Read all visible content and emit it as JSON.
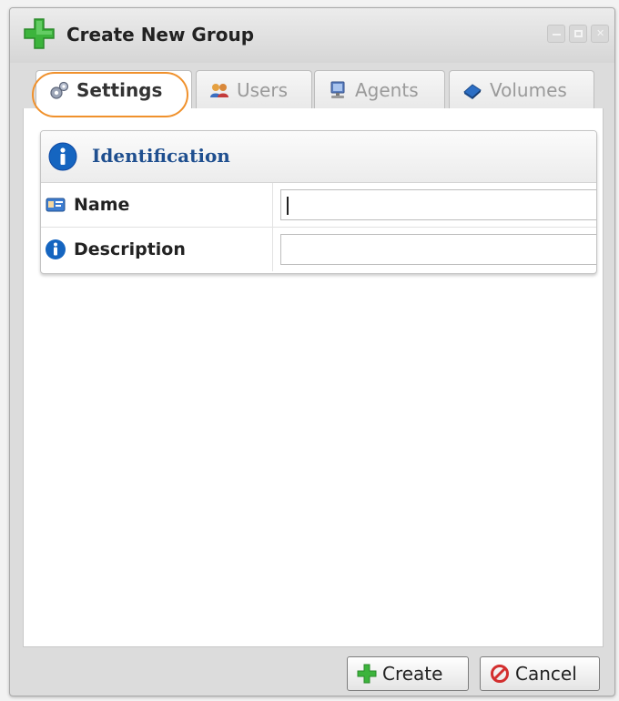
{
  "window": {
    "title": "Create New Group"
  },
  "tabs": [
    {
      "label": "Settings",
      "icon": "gears-icon",
      "active": true
    },
    {
      "label": "Users",
      "icon": "users-icon",
      "active": false
    },
    {
      "label": "Agents",
      "icon": "computer-icon",
      "active": false
    },
    {
      "label": "Volumes",
      "icon": "disk-icon",
      "active": false
    }
  ],
  "identification": {
    "title": "Identification",
    "fields": [
      {
        "label": "Name",
        "icon": "id-card-icon",
        "value": ""
      },
      {
        "label": "Description",
        "icon": "info-icon",
        "value": ""
      }
    ]
  },
  "footer": {
    "create_label": "Create",
    "cancel_label": "Cancel"
  },
  "colors": {
    "accent_green": "#3cb43c",
    "highlight_orange": "#f0912c",
    "panel_title_blue": "#1f4f8f",
    "info_blue": "#1565c0",
    "cancel_red": "#d32f2f"
  }
}
